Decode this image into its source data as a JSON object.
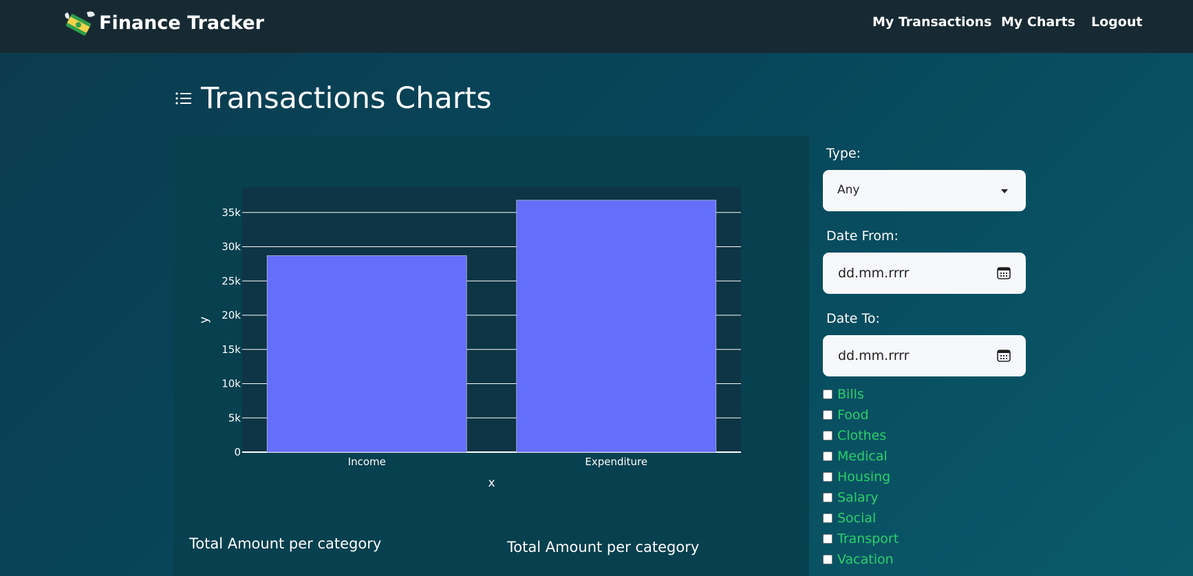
{
  "navbar": {
    "brand": "Finance Tracker",
    "links": [
      "My Transactions",
      "My Charts",
      "Logout"
    ]
  },
  "page": {
    "title": "Transactions Charts"
  },
  "chart_data": {
    "type": "bar",
    "categories": [
      "Income",
      "Expenditure"
    ],
    "values": [
      28700,
      36800
    ],
    "xlabel": "x",
    "ylabel": "y",
    "ylim": [
      0,
      38700
    ],
    "yticks": [
      0,
      5000,
      10000,
      15000,
      20000,
      25000,
      30000,
      35000
    ],
    "ytick_labels": [
      "0",
      "5k",
      "10k",
      "15k",
      "20k",
      "25k",
      "30k",
      "35k"
    ],
    "grid": true,
    "bar_color": "#636efa"
  },
  "bottom_titles": [
    "Total Amount per category",
    "Total Amount per category"
  ],
  "filters": {
    "type_label": "Type:",
    "type_value": "Any",
    "date_from_label": "Date From:",
    "date_from_value": "dd.mm.rrrr",
    "date_to_label": "Date To:",
    "date_to_value": "dd.mm.rrrr",
    "categories": [
      "Bills",
      "Food",
      "Clothes",
      "Medical",
      "Housing",
      "Salary",
      "Social",
      "Transport",
      "Vacation"
    ]
  },
  "colors": {
    "navbar_bg": "#172a33",
    "plot_bg": "#0d3545",
    "bar": "#636efa",
    "category_text": "#2ad06a"
  }
}
